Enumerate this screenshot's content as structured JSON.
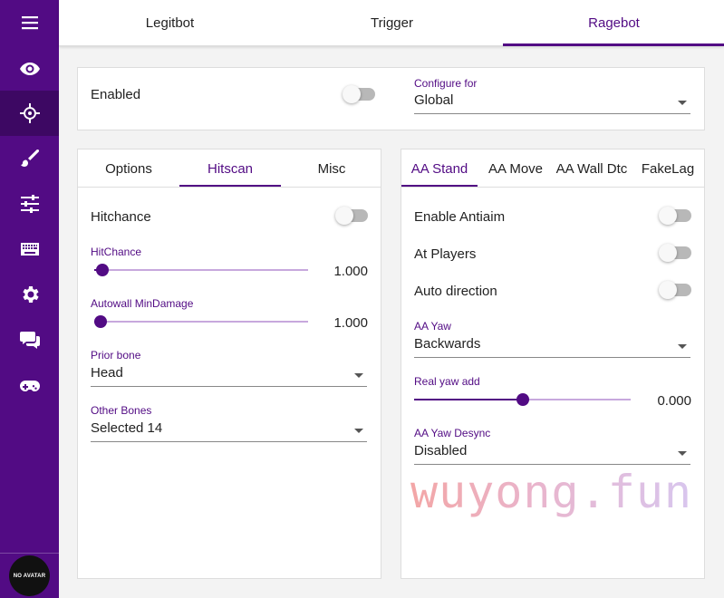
{
  "colors": {
    "accent": "#520b84",
    "sidebar": "#520b84",
    "sidebar_active": "#3d0863"
  },
  "sidebar": {
    "items": [
      {
        "icon": "menu-icon"
      },
      {
        "icon": "eye-icon"
      },
      {
        "icon": "crosshair-icon",
        "active": true
      },
      {
        "icon": "brush-icon"
      },
      {
        "icon": "sliders-icon"
      },
      {
        "icon": "keyboard-icon"
      },
      {
        "icon": "gear-icon"
      },
      {
        "icon": "chat-icon"
      },
      {
        "icon": "gamepad-icon"
      }
    ],
    "avatar_text": "NO AVATAR"
  },
  "top_tabs": [
    {
      "label": "Legitbot"
    },
    {
      "label": "Trigger"
    },
    {
      "label": "Ragebot",
      "active": true
    }
  ],
  "header_card": {
    "enabled_label": "Enabled",
    "enabled_on": false,
    "configure_label": "Configure for",
    "configure_value": "Global"
  },
  "left_panel": {
    "tabs": [
      "Options",
      "Hitscan",
      "Misc"
    ],
    "active_tab": "Hitscan",
    "hitchance_label": "Hitchance",
    "hitchance_on": false,
    "hitchance_slider": {
      "label": "HitChance",
      "value": "1.000",
      "fraction": 0.04
    },
    "autowall_slider": {
      "label": "Autowall MinDamage",
      "value": "1.000",
      "fraction": 0.03
    },
    "prior_bone": {
      "label": "Prior bone",
      "value": "Head"
    },
    "other_bones": {
      "label": "Other Bones",
      "value": "Selected 14"
    }
  },
  "right_panel": {
    "tabs": [
      "AA Stand",
      "AA Move",
      "AA Wall Dtc",
      "FakeLag"
    ],
    "active_tab": "AA Stand",
    "enable_antiaim": {
      "label": "Enable Antiaim",
      "on": false
    },
    "at_players": {
      "label": "At Players",
      "on": false
    },
    "auto_direction": {
      "label": "Auto direction",
      "on": false
    },
    "aa_yaw": {
      "label": "AA Yaw",
      "value": "Backwards"
    },
    "real_yaw_add": {
      "label": "Real yaw add",
      "value": "0.000",
      "fraction": 0.5
    },
    "aa_yaw_desync": {
      "label": "AA Yaw Desync",
      "value": "Disabled"
    }
  },
  "watermark": "wuyong.fun"
}
